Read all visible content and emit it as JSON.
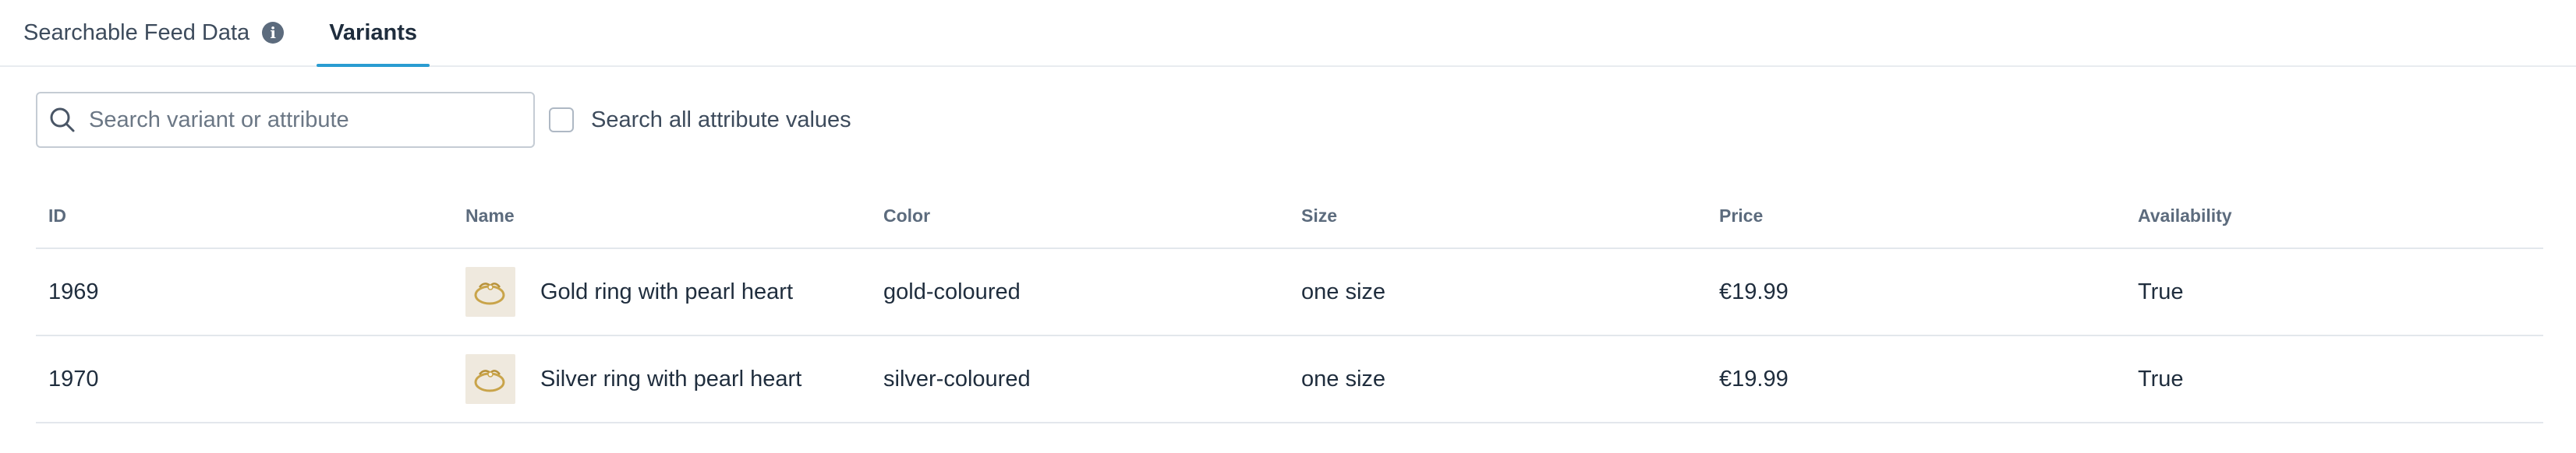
{
  "tabs": {
    "feed_label": "Searchable Feed Data",
    "variants_label": "Variants"
  },
  "search": {
    "placeholder": "Search variant or attribute",
    "value": ""
  },
  "search_all": {
    "label": "Search all attribute values",
    "checked": false
  },
  "table": {
    "headers": [
      "ID",
      "Name",
      "Color",
      "Size",
      "Price",
      "Availability"
    ],
    "rows": [
      {
        "id": "1969",
        "name": "Gold ring with pearl heart",
        "color": "gold-coloured",
        "size": "one size",
        "price": "€19.99",
        "availability": "True"
      },
      {
        "id": "1970",
        "name": "Silver ring with pearl heart",
        "color": "silver-coloured",
        "size": "one size",
        "price": "€19.99",
        "availability": "True"
      }
    ]
  },
  "colors": {
    "accent": "#2a9cd1",
    "text": "#1f2d3d",
    "muted": "#5c6b7d"
  },
  "icons": {
    "info": "info-icon",
    "search": "search-icon",
    "thumbnail": "ring-thumbnail"
  }
}
